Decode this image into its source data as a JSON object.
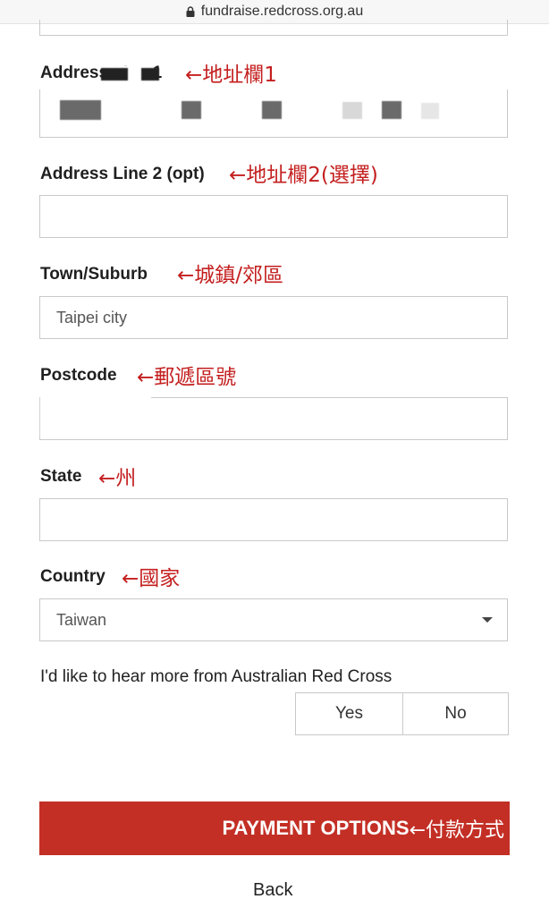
{
  "browser": {
    "url": "fundraise.redcross.org.au"
  },
  "form": {
    "address1": {
      "label": "Address Line 1",
      "note": "←地址欄1"
    },
    "address2": {
      "label": "Address Line 2 (opt)",
      "note": "←地址欄2(選擇)",
      "value": ""
    },
    "town": {
      "label": "Town/Suburb",
      "note": "←城鎮/郊區",
      "value": "Taipei city"
    },
    "postcode": {
      "label": "Postcode",
      "note": "←郵遞區號"
    },
    "state": {
      "label": "State",
      "note": "←州",
      "value": ""
    },
    "country": {
      "label": "Country",
      "note": "←國家",
      "selected": "Taiwan"
    },
    "hear_more": {
      "question": "I'd like to hear more from Australian Red Cross",
      "yes": "Yes",
      "no": "No"
    },
    "payment": {
      "label": "PAYMENT OPTIONS",
      "note": "←付款方式"
    },
    "back": "Back"
  },
  "colors": {
    "accent": "#c32f25",
    "annotation": "#c41f1f"
  }
}
